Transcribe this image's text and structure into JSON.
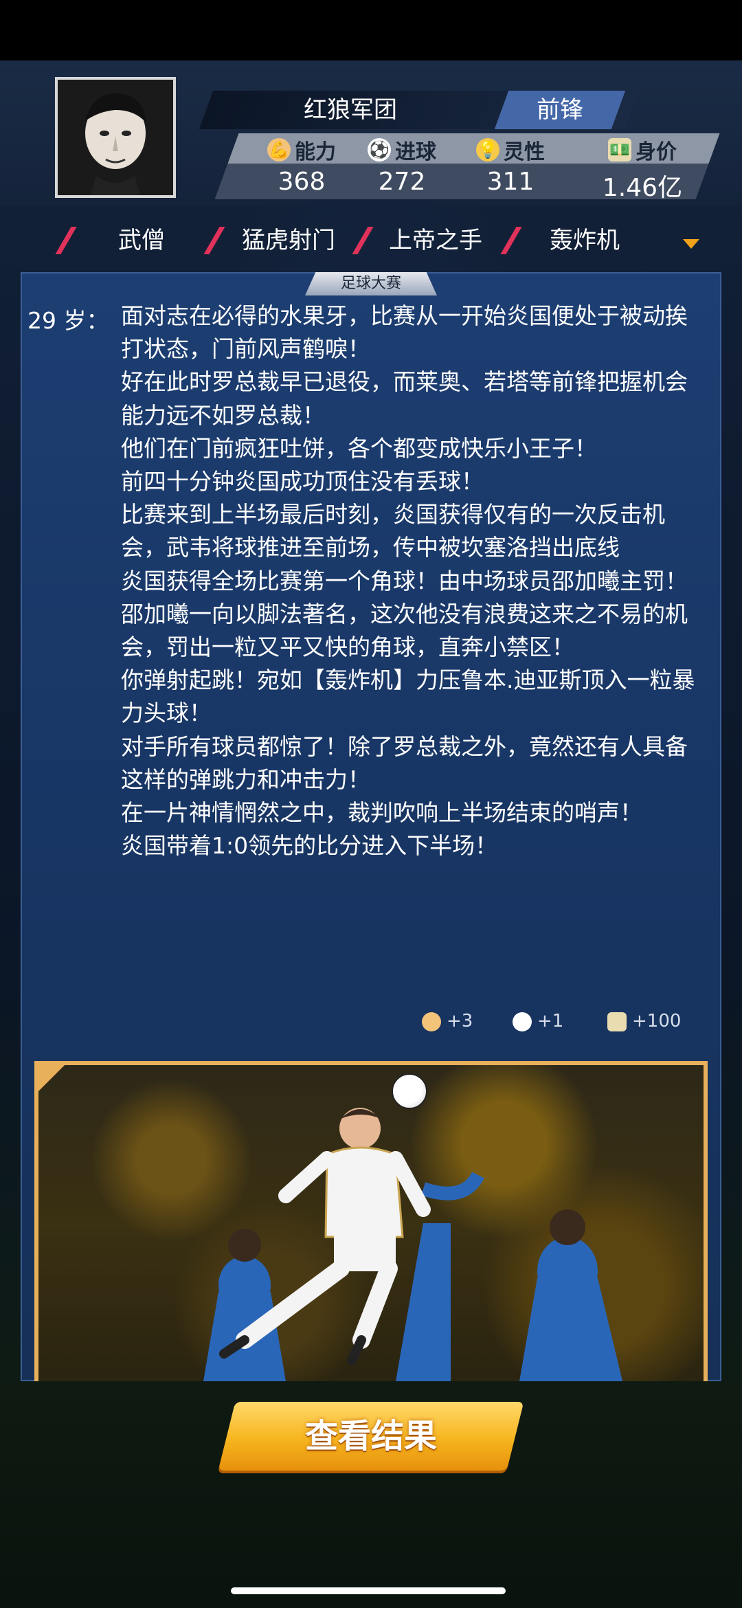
{
  "profile": {
    "team": "红狼军团",
    "position": "前锋",
    "stats": [
      {
        "label": "能力",
        "value": "368",
        "icon": "muscle-icon"
      },
      {
        "label": "进球",
        "value": "272",
        "icon": "soccer-ball-icon"
      },
      {
        "label": "灵性",
        "value": "311",
        "icon": "lightbulb-icon"
      },
      {
        "label": "身价",
        "value": "1.46亿",
        "icon": "money-icon"
      }
    ]
  },
  "skills": [
    "武僧",
    "猛虎射门",
    "上帝之手",
    "轰炸机"
  ],
  "event": {
    "tab": "足球大赛",
    "age": "29 岁：",
    "lines": [
      "面对志在必得的水果牙，比赛从一开始炎国便处于被动挨打状态，门前风声鹤唳！",
      "好在此时罗总裁早已退役，而莱奥、若塔等前锋把握机会能力远不如罗总裁！",
      "他们在门前疯狂吐饼，各个都变成快乐小王子！",
      "前四十分钟炎国成功顶住没有丢球！",
      "比赛来到上半场最后时刻，炎国获得仅有的一次反击机会，武韦将球推进至前场，传中被坎塞洛挡出底线",
      "炎国获得全场比赛第一个角球！由中场球员邵加曦主罚！",
      "邵加曦一向以脚法著名，这次他没有浪费这来之不易的机会，罚出一粒又平又快的角球，直奔小禁区！",
      "你弹射起跳！宛如【轰炸机】力压鲁本.迪亚斯顶入一粒暴力头球！",
      "对手所有球员都惊了！除了罗总裁之外，竟然还有人具备这样的弹跳力和冲击力！",
      "在一片神情惘然之中，裁判吹响上半场结束的哨声！",
      "炎国带着1:0领先的比分进入下半场！"
    ],
    "rewards": [
      {
        "icon": "muscle-icon",
        "value": "+3"
      },
      {
        "icon": "soccer-ball-icon",
        "value": "+1"
      },
      {
        "icon": "money-icon",
        "value": "+100"
      }
    ]
  },
  "actions": {
    "view_result": "查看结果"
  },
  "colors": {
    "accent_slash": "#e0325a",
    "button": "#f6b51e",
    "panel": "#1d3e72",
    "frame": "#e8b05a"
  }
}
